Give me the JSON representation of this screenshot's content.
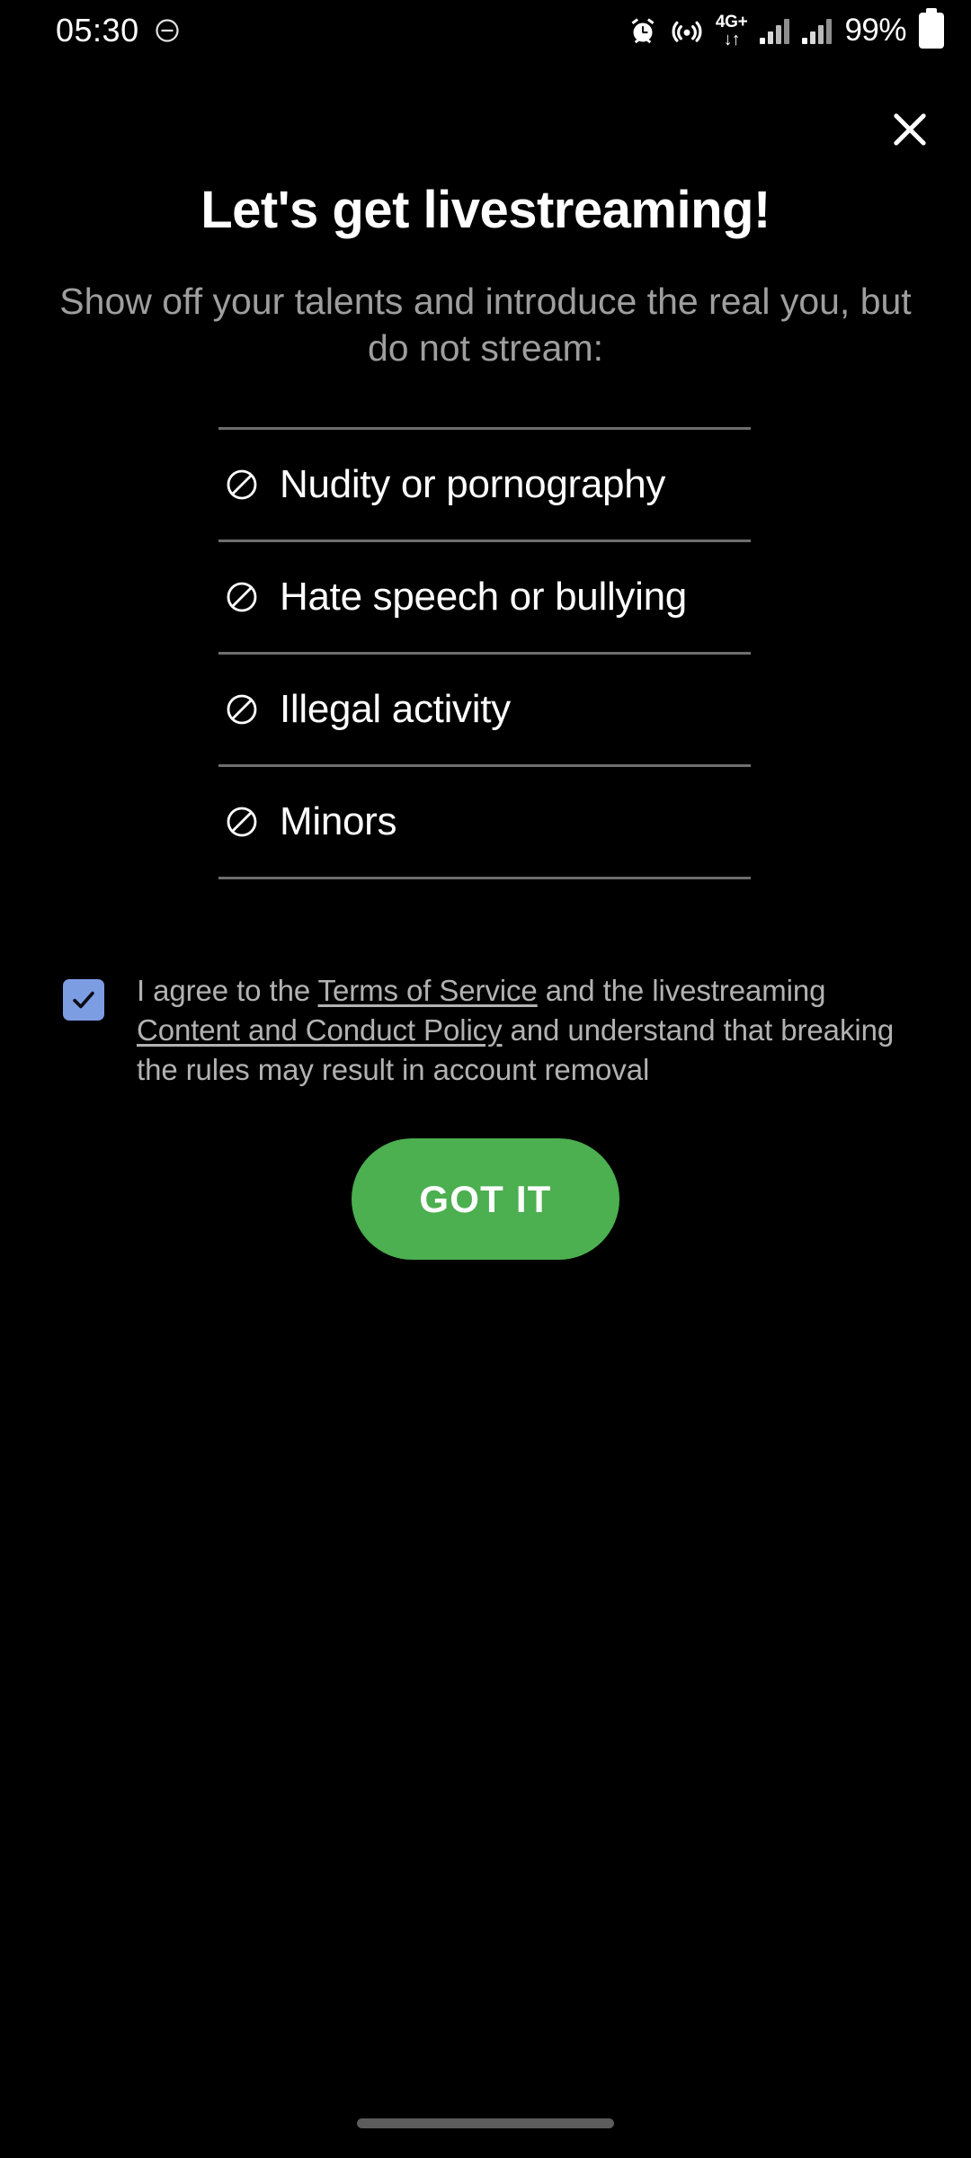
{
  "status_bar": {
    "time": "05:30",
    "dnd_icon": "do-not-disturb-icon",
    "alarm_icon": "alarm-clock-icon",
    "hotspot_icon": "hotspot-icon",
    "network_type": "4G+",
    "data_arrows": "↓↑",
    "battery_percent": "99%",
    "battery_icon": "battery-full-icon"
  },
  "dialog": {
    "close_icon": "close-icon",
    "title": "Let's get livestreaming!",
    "subtitle": "Show off your talents and introduce the real you, but do not stream:",
    "rules": [
      {
        "icon": "prohibited-icon",
        "label": "Nudity or pornography"
      },
      {
        "icon": "prohibited-icon",
        "label": "Hate speech or bullying"
      },
      {
        "icon": "prohibited-icon",
        "label": "Illegal activity"
      },
      {
        "icon": "prohibited-icon",
        "label": "Minors"
      }
    ],
    "agreement": {
      "checked": true,
      "part1": "I agree to the ",
      "link1": "Terms of Service",
      "part2": " and the livestreaming ",
      "link2": "Content and Conduct Policy",
      "part3": " and understand that breaking the rules may result in account removal"
    },
    "cta_label": "GOT IT"
  },
  "colors": {
    "background": "#000000",
    "accent_green": "#4caf50",
    "checkbox_blue": "#7d9de3",
    "divider": "#6e6e6e",
    "muted_text": "#9e9e9e",
    "agreement_text": "#b2b2b2"
  }
}
